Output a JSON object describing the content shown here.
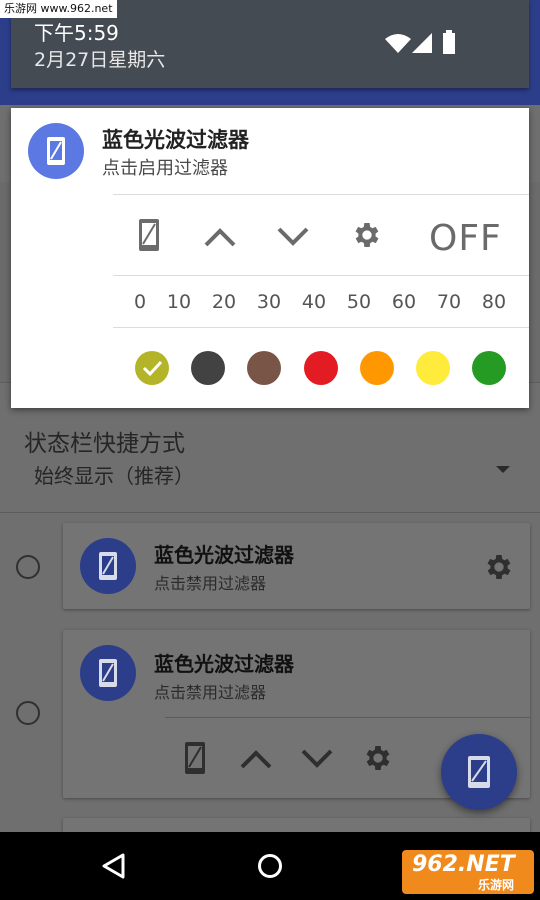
{
  "watermark": {
    "text": "乐游网 www.962.net"
  },
  "status_bar": {
    "time": "下午5:59",
    "date": "2月27日星期六"
  },
  "notification": {
    "title": "蓝色光波过滤器",
    "subtitle": "点击启用过滤器",
    "toggle_label": "OFF",
    "scale": [
      "0",
      "10",
      "20",
      "30",
      "40",
      "50",
      "60",
      "70",
      "80"
    ],
    "colors": [
      "#b4b428",
      "#424242",
      "#795548",
      "#e31c23",
      "#ff9800",
      "#ffeb3b",
      "#259b24"
    ],
    "icons": [
      "phone-icon",
      "chevron-up-icon",
      "chevron-down-icon",
      "gear-icon"
    ]
  },
  "settings": {
    "shortcut_title": "状态栏快捷方式",
    "shortcut_value": "始终显示（推荐）"
  },
  "options": [
    {
      "title": "蓝色光波过滤器",
      "subtitle": "点击禁用过滤器"
    },
    {
      "title": "蓝色光波过滤器",
      "subtitle": "点击禁用过滤器"
    }
  ],
  "colors": {
    "accent_blue": "#5b78e3",
    "dark_blue": "#2c3d8a"
  },
  "logo": {
    "text": "962.NET",
    "subtext": "乐游网"
  }
}
